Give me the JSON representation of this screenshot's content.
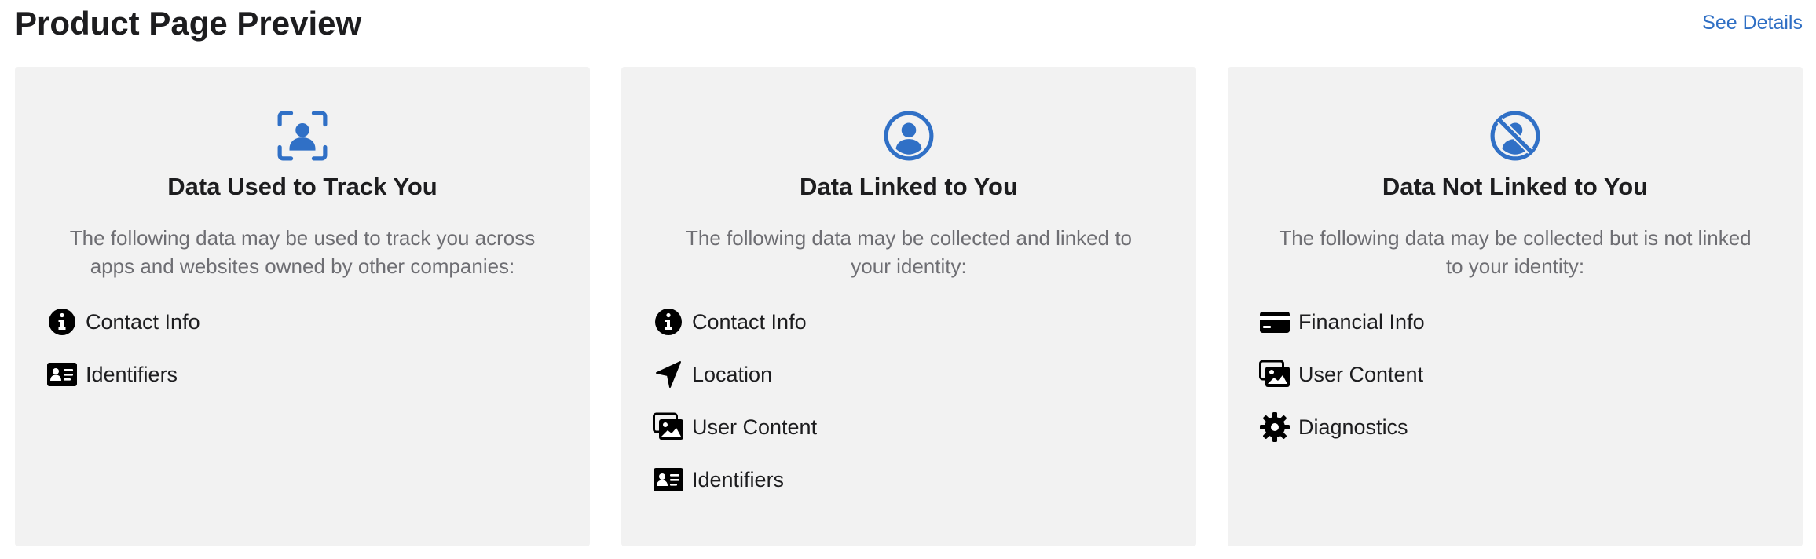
{
  "header": {
    "title": "Product Page Preview",
    "see_details": "See Details"
  },
  "accent_color": "#3070c6",
  "cards": [
    {
      "icon": "tracking-icon",
      "title": "Data Used to Track You",
      "description": "The following data may be used to track you across apps and websites owned by other companies:",
      "items": [
        {
          "icon": "info-icon",
          "label": "Contact Info"
        },
        {
          "icon": "id-card-icon",
          "label": "Identifiers"
        }
      ]
    },
    {
      "icon": "person-circle-icon",
      "title": "Data Linked to You",
      "description": "The following data may be collected and linked to your identity:",
      "items": [
        {
          "icon": "info-icon",
          "label": "Contact Info"
        },
        {
          "icon": "location-arrow-icon",
          "label": "Location"
        },
        {
          "icon": "photos-icon",
          "label": "User Content"
        },
        {
          "icon": "id-card-icon",
          "label": "Identifiers"
        }
      ]
    },
    {
      "icon": "person-slash-icon",
      "title": "Data Not Linked to You",
      "description": "The following data may be collected but is not linked to your identity:",
      "items": [
        {
          "icon": "credit-card-icon",
          "label": "Financial Info"
        },
        {
          "icon": "photos-icon",
          "label": "User Content"
        },
        {
          "icon": "gear-icon",
          "label": "Diagnostics"
        }
      ]
    }
  ]
}
